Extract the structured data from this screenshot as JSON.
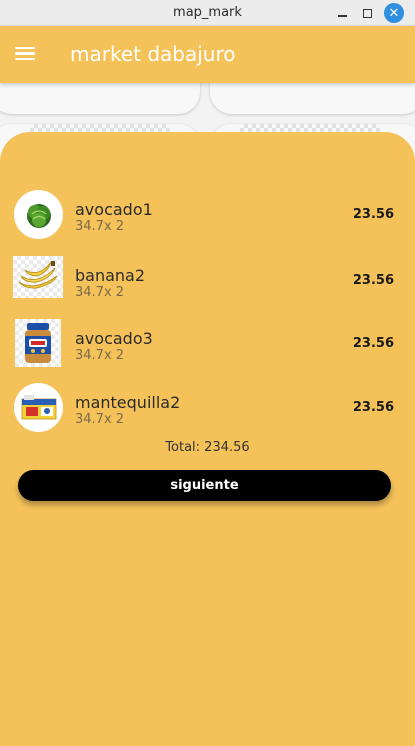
{
  "window": {
    "title": "map_mark",
    "minimize_icon": "minimize-icon",
    "maximize_icon": "maximize-icon",
    "close_icon": "close-icon",
    "close_glyph": "✕"
  },
  "appbar": {
    "title": "market dabajuro",
    "menu_icon": "hamburger-menu-icon",
    "color": "#f5c25a"
  },
  "cart": {
    "items": [
      {
        "name": "avocado1",
        "detail": "34.7x 2",
        "price": "23.56",
        "image": "lettuce-image"
      },
      {
        "name": "banana2",
        "detail": "34.7x 2",
        "price": "23.56",
        "image": "banana-image"
      },
      {
        "name": "avocado3",
        "detail": "34.7x 2",
        "price": "23.56",
        "image": "peanut-butter-jar-image"
      },
      {
        "name": "mantequilla2",
        "detail": "34.7x 2",
        "price": "23.56",
        "image": "butter-box-image"
      }
    ],
    "total": "Total: 234.56",
    "next_button": "siguiente"
  },
  "colors": {
    "sheet": "#f5c25a",
    "button": "#000000",
    "close_button": "#2f8fe0"
  }
}
